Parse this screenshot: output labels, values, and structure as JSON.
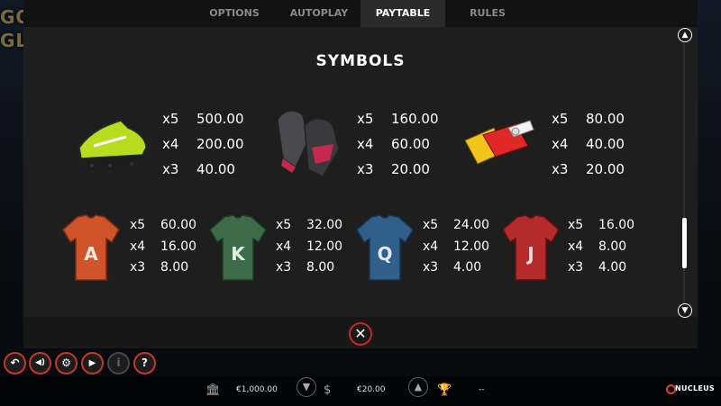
{
  "background": {
    "logo_text": "GO GL"
  },
  "tabs": [
    {
      "label": "OPTIONS",
      "active": false
    },
    {
      "label": "AUTOPLAY",
      "active": false
    },
    {
      "label": "PAYTABLE",
      "active": true
    },
    {
      "label": "RULES",
      "active": false
    }
  ],
  "paytable": {
    "title": "SYMBOLS",
    "top_symbols": [
      {
        "icon": "football-boot-icon",
        "pays": [
          {
            "mult": "x5",
            "value": "500.00"
          },
          {
            "mult": "x4",
            "value": "200.00"
          },
          {
            "mult": "x3",
            "value": "40.00"
          }
        ]
      },
      {
        "icon": "goalkeeper-gloves-icon",
        "pays": [
          {
            "mult": "x5",
            "value": "160.00"
          },
          {
            "mult": "x4",
            "value": "60.00"
          },
          {
            "mult": "x3",
            "value": "20.00"
          }
        ]
      },
      {
        "icon": "referee-cards-whistle-icon",
        "pays": [
          {
            "mult": "x5",
            "value": "80.00"
          },
          {
            "mult": "x4",
            "value": "40.00"
          },
          {
            "mult": "x3",
            "value": "20.00"
          }
        ]
      }
    ],
    "shirt_symbols": [
      {
        "icon": "jersey-a-icon",
        "letter": "A",
        "color": "#d0532a",
        "pays": [
          {
            "mult": "x5",
            "value": "60.00"
          },
          {
            "mult": "x4",
            "value": "16.00"
          },
          {
            "mult": "x3",
            "value": "8.00"
          }
        ]
      },
      {
        "icon": "jersey-k-icon",
        "letter": "K",
        "color": "#3e6b4a",
        "pays": [
          {
            "mult": "x5",
            "value": "32.00"
          },
          {
            "mult": "x4",
            "value": "12.00"
          },
          {
            "mult": "x3",
            "value": "8.00"
          }
        ]
      },
      {
        "icon": "jersey-q-icon",
        "letter": "Q",
        "color": "#2f5f8a",
        "pays": [
          {
            "mult": "x5",
            "value": "24.00"
          },
          {
            "mult": "x4",
            "value": "12.00"
          },
          {
            "mult": "x3",
            "value": "4.00"
          }
        ]
      },
      {
        "icon": "jersey-j-icon",
        "letter": "J",
        "color": "#b52a2a",
        "pays": [
          {
            "mult": "x5",
            "value": "16.00"
          },
          {
            "mult": "x4",
            "value": "8.00"
          },
          {
            "mult": "x3",
            "value": "4.00"
          }
        ]
      }
    ]
  },
  "controls": {
    "back": "↶",
    "sound": "◀)",
    "settings": "⚙",
    "play": "▶",
    "info": "i",
    "help": "?"
  },
  "bottom_bar": {
    "balance": "€1,000.00",
    "bet": "€20.00",
    "win": "--",
    "brand": "NUCLEUS"
  }
}
